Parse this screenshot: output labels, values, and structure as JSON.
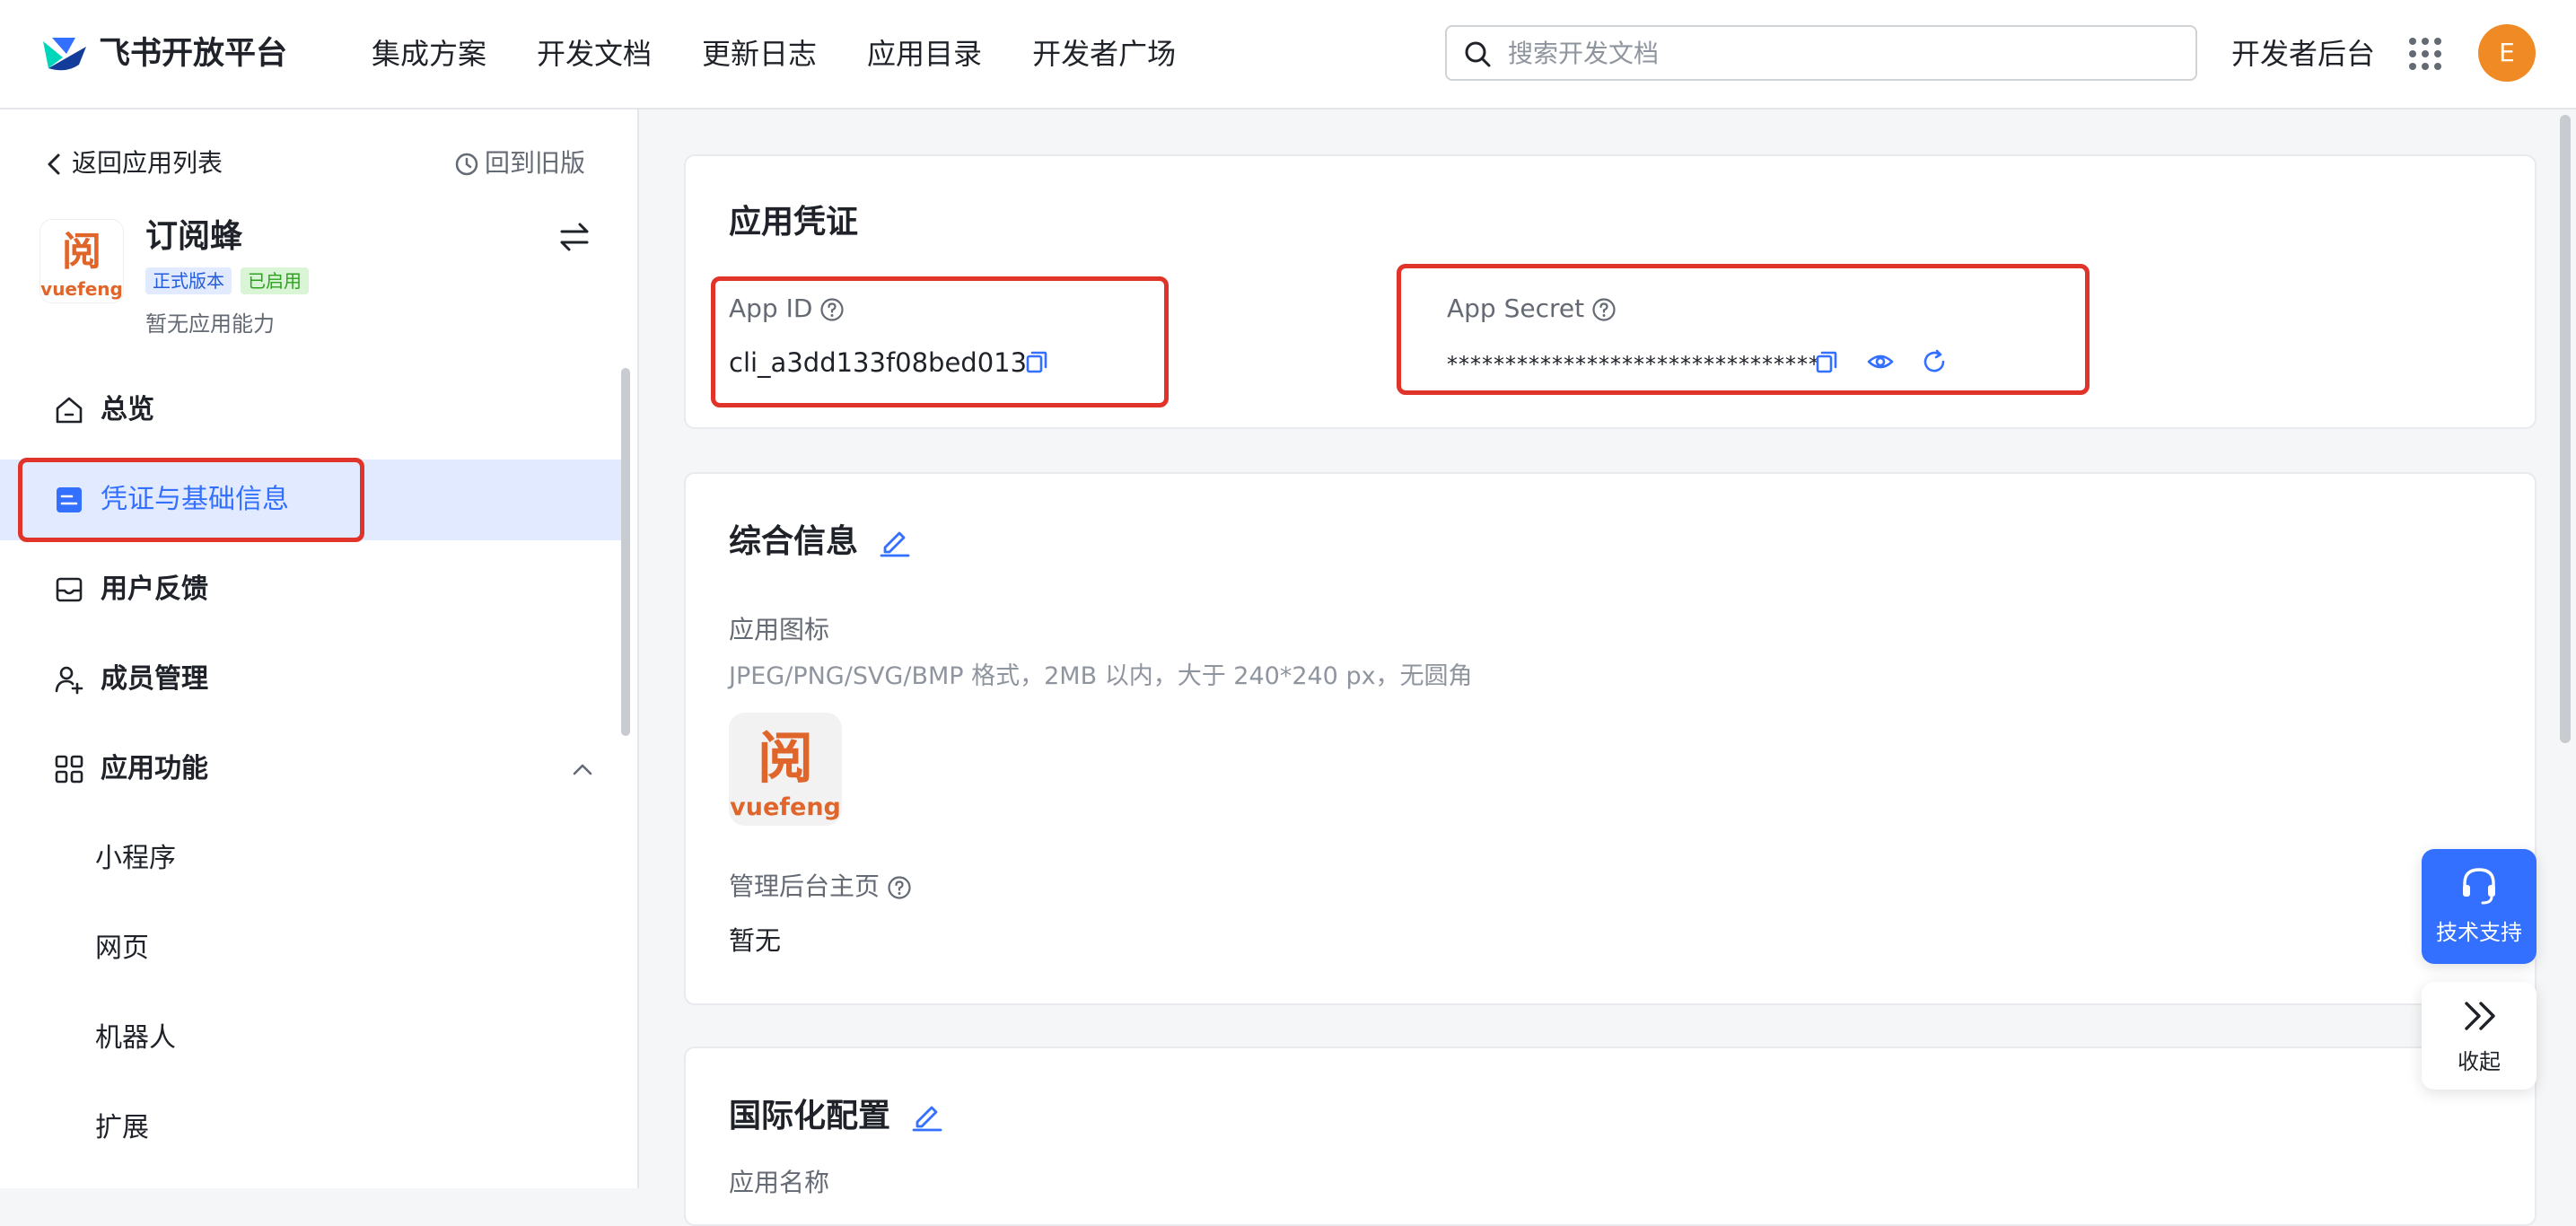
{
  "header": {
    "brand": "飞书开放平台",
    "nav": [
      "集成方案",
      "开发文档",
      "更新日志",
      "应用目录",
      "开发者广场"
    ],
    "search_placeholder": "搜索开发文档",
    "dev_console": "开发者后台",
    "avatar_letter": "E"
  },
  "sidebar": {
    "back_label": "返回应用列表",
    "old_version_label": "回到旧版",
    "app": {
      "name": "订阅蜂",
      "badge_release": "正式版本",
      "badge_status": "已启用",
      "description": "暂无应用能力",
      "logo_text_top": "阅",
      "logo_text_bottom": "vuefeng"
    },
    "menu": [
      {
        "label": "总览",
        "icon": "home-icon"
      },
      {
        "label": "凭证与基础信息",
        "icon": "credential-icon",
        "active": true
      },
      {
        "label": "用户反馈",
        "icon": "inbox-icon"
      },
      {
        "label": "成员管理",
        "icon": "user-add-icon"
      },
      {
        "label": "应用功能",
        "icon": "apps-grid-icon",
        "expanded": true
      }
    ],
    "sub_items": [
      "小程序",
      "网页",
      "机器人",
      "扩展"
    ]
  },
  "credentials": {
    "title": "应用凭证",
    "app_id_label": "App ID",
    "app_id_value": "cli_a3dd133f08bed013",
    "app_secret_label": "App Secret",
    "app_secret_value": "********************************"
  },
  "general": {
    "title": "综合信息",
    "icon_label": "应用图标",
    "icon_hint": "JPEG/PNG/SVG/BMP 格式，2MB 以内，大于 240*240 px，无圆角",
    "homepage_label": "管理后台主页",
    "homepage_value": "暂无"
  },
  "i18n": {
    "title": "国际化配置",
    "app_name_label": "应用名称"
  },
  "floating": {
    "support_label": "技术支持",
    "collapse_label": "收起"
  },
  "colors": {
    "accent": "#3370ff",
    "highlight_box": "#e0332a",
    "avatar": "#f08a24"
  }
}
